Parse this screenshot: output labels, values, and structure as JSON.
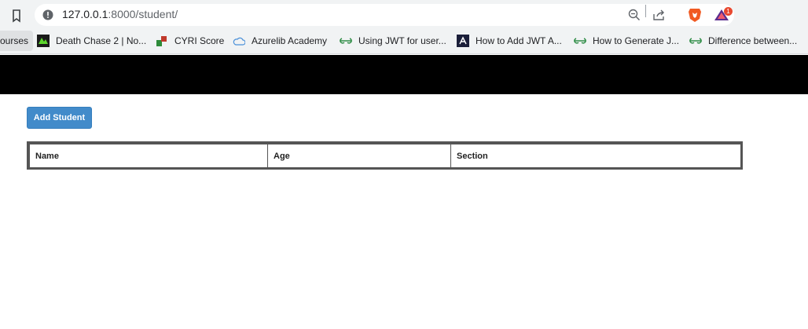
{
  "browser": {
    "url_host": "127.0.0.1",
    "url_rest": ":8000/student/",
    "extension_badge": "1",
    "bookmarks": [
      {
        "label": "ourses",
        "icon": "none"
      },
      {
        "label": "Death Chase 2 | No...",
        "icon": "game-icon"
      },
      {
        "label": "CYRI Score",
        "icon": "puzzle-icon"
      },
      {
        "label": "Azurelib Academy",
        "icon": "cloud-icon"
      },
      {
        "label": "Using JWT for user...",
        "icon": "gfg-icon"
      },
      {
        "label": "How to Add JWT A...",
        "icon": "dev-icon"
      },
      {
        "label": "How to Generate J...",
        "icon": "gfg-icon"
      },
      {
        "label": "Difference between...",
        "icon": "gfg-icon"
      }
    ]
  },
  "page": {
    "add_button_label": "Add Student",
    "table": {
      "columns": [
        "Name",
        "Age",
        "Section"
      ],
      "rows": []
    }
  },
  "colors": {
    "navbar": "#000000",
    "primary_button": "#428bca",
    "table_border": "#555555"
  }
}
